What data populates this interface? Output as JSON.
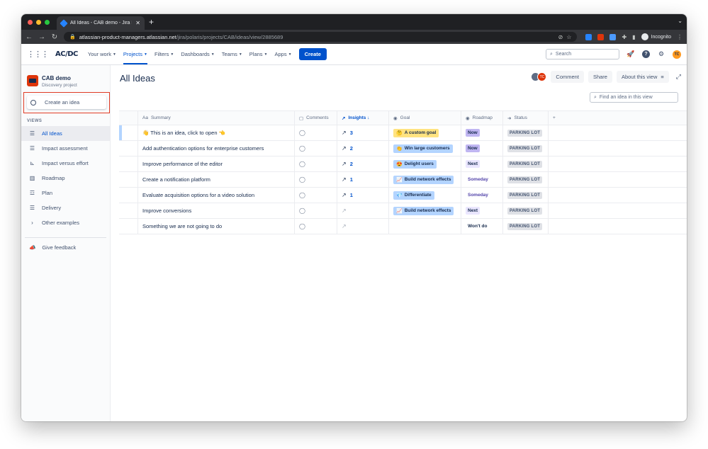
{
  "browser": {
    "tab_title": "All Ideas - CAB demo - Jira Pro",
    "url_host": "atlassian-product-managers.atlassian.net",
    "url_path": "/jira/polaris/projects/CAB/ideas/view/2885689",
    "profile_label": "Incognito"
  },
  "jira_nav": {
    "logo": "AC/DC",
    "items": [
      "Your work",
      "Projects",
      "Filters",
      "Dashboards",
      "Teams",
      "Plans",
      "Apps"
    ],
    "create_label": "Create",
    "search_placeholder": "Search",
    "user_initials": "TC"
  },
  "sidebar": {
    "project_name": "CAB demo",
    "project_type": "Discovery project",
    "create_idea_label": "Create an idea",
    "views_heading": "VIEWS",
    "views": [
      {
        "label": "All Ideas",
        "icon": "list-icon"
      },
      {
        "label": "Impact assessment",
        "icon": "list-icon"
      },
      {
        "label": "Impact versus effort",
        "icon": "matrix-icon"
      },
      {
        "label": "Roadmap",
        "icon": "board-icon"
      },
      {
        "label": "Plan",
        "icon": "timeline-icon"
      },
      {
        "label": "Delivery",
        "icon": "list-icon"
      },
      {
        "label": "Other examples",
        "icon": "chevron-right-icon"
      }
    ],
    "feedback_label": "Give feedback"
  },
  "main": {
    "title": "All Ideas",
    "comment_label": "Comment",
    "share_label": "Share",
    "about_label": "About this view",
    "avatar_initials": "TC",
    "find_placeholder": "Find an idea in this view",
    "columns": [
      "Summary",
      "Comments",
      "Insights ↓",
      "Goal",
      "Roadmap",
      "Status"
    ],
    "rows": [
      {
        "summary": "👋 This is an idea, click to open 👈",
        "insights": "3",
        "goal": "A custom goal",
        "goal_emoji": "🤔",
        "goal_color": "#ffe380",
        "roadmap": "Now",
        "roadmap_color": "#c0b6f2",
        "status": "PARKING LOT"
      },
      {
        "summary": "Add authentication options for enterprise customers",
        "insights": "2",
        "goal": "Win large customers",
        "goal_emoji": "👏",
        "goal_color": "#b3d4ff",
        "roadmap": "Now",
        "roadmap_color": "#c0b6f2",
        "status": "PARKING LOT"
      },
      {
        "summary": "Improve performance of the editor",
        "insights": "2",
        "goal": "Delight users",
        "goal_emoji": "😍",
        "goal_color": "#b3d4ff",
        "roadmap": "Next",
        "roadmap_color": "#eae6ff",
        "status": "PARKING LOT"
      },
      {
        "summary": "Create a notification platform",
        "insights": "1",
        "goal": "Build network effects",
        "goal_emoji": "📈",
        "goal_color": "#b3d4ff",
        "roadmap": "Someday",
        "roadmap_color": "#ffffff",
        "status": "PARKING LOT"
      },
      {
        "summary": "Evaluate acquisition options for a video solution",
        "insights": "1",
        "goal": "Differentiate",
        "goal_emoji": "💎",
        "goal_color": "#b3d4ff",
        "roadmap": "Someday",
        "roadmap_color": "#ffffff",
        "status": "PARKING LOT"
      },
      {
        "summary": "Improve conversions",
        "insights": "",
        "goal": "Build network effects",
        "goal_emoji": "📈",
        "goal_color": "#b3d4ff",
        "roadmap": "Next",
        "roadmap_color": "#eae6ff",
        "status": "PARKING LOT"
      },
      {
        "summary": "Something we are not going to do",
        "insights": "",
        "goal": "",
        "goal_emoji": "",
        "goal_color": "",
        "roadmap": "Won't do",
        "roadmap_color": "#ffffff",
        "status": "PARKING LOT"
      }
    ]
  }
}
